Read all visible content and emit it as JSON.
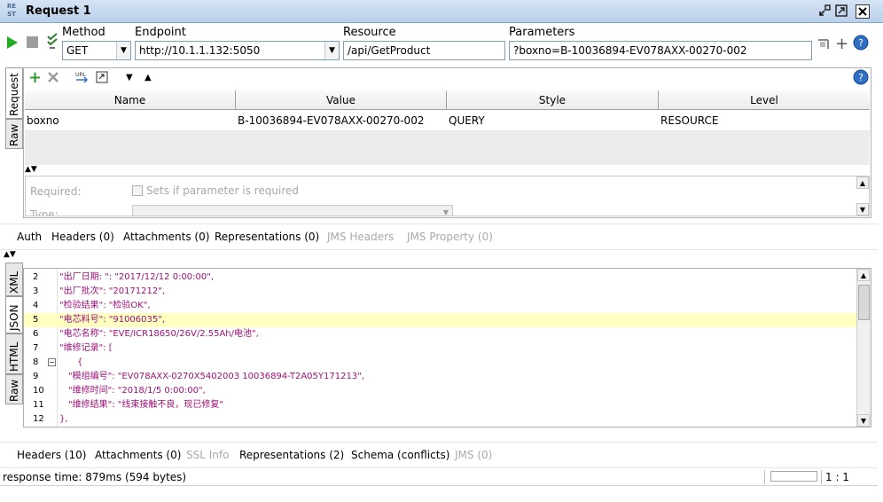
{
  "window": {
    "app_logo_text": "RE ST",
    "title": "Request 1",
    "controls": [
      "detach-icon",
      "maximize-icon",
      "close-icon"
    ]
  },
  "toolbar": {
    "method_label": "Method",
    "method_value": "GET",
    "endpoint_label": "Endpoint",
    "endpoint_value": "http://10.1.1.132:5050",
    "resource_label": "Resource",
    "resource_value": "/api/GetProduct",
    "parameters_label": "Parameters",
    "parameters_value": "?boxno=B-10036894-EV078AXX-00270-002"
  },
  "side_tabs_top": [
    "Request",
    "Raw"
  ],
  "params_table": {
    "columns": [
      "Name",
      "Value",
      "Style",
      "Level"
    ],
    "rows": [
      [
        "boxno",
        "B-10036894-EV078AXX-00270-002",
        "QUERY",
        "RESOURCE"
      ]
    ]
  },
  "param_detail": {
    "required_label": "Required:",
    "required_checkbox_text": "Sets if parameter is required",
    "type_label": "Type:"
  },
  "request_tabs": [
    {
      "label": "Auth",
      "disabled": false
    },
    {
      "label": "Headers (0)",
      "disabled": false
    },
    {
      "label": "Attachments (0)",
      "disabled": false
    },
    {
      "label": "Representations (0)",
      "disabled": false
    },
    {
      "label": "JMS Headers",
      "disabled": true
    },
    {
      "label": "JMS Property (0)",
      "disabled": true
    }
  ],
  "side_tabs_bottom": [
    "XML",
    "JSON",
    "HTML",
    "Raw"
  ],
  "response_code": {
    "lines": [
      {
        "n": "2",
        "text": "\"出厂日期: \": \"2017/12/12 0:00:00\",",
        "indent": 0,
        "highlight": false,
        "fold": false
      },
      {
        "n": "3",
        "text": "\"出厂批次\": \"20171212\",",
        "indent": 0,
        "highlight": false,
        "fold": false
      },
      {
        "n": "4",
        "text": "\"检验结果\": \"检验OK\",",
        "indent": 0,
        "highlight": false,
        "fold": false
      },
      {
        "n": "5",
        "text": "\"电芯料号\": \"91006035\",",
        "indent": 0,
        "highlight": true,
        "fold": false
      },
      {
        "n": "6",
        "text": "\"电芯名称\": \"EVE/ICR18650/26V/2.55Ah/电池\",",
        "indent": 0,
        "highlight": false,
        "fold": false
      },
      {
        "n": "7",
        "text": "\"维修记录\":   [",
        "indent": 0,
        "highlight": false,
        "fold": false
      },
      {
        "n": "8",
        "text": "{",
        "indent": 2,
        "highlight": false,
        "fold": true
      },
      {
        "n": "9",
        "text": "\"模组编号\": \"EV078AXX-0270X5402003 10036894-T2A05Y171213\",",
        "indent": 1,
        "highlight": false,
        "fold": false
      },
      {
        "n": "10",
        "text": "\"维修时间\": \"2018/1/5 0:00:00\",",
        "indent": 1,
        "highlight": false,
        "fold": false
      },
      {
        "n": "11",
        "text": "\"维修结果\": \"线束接触不良，现已修复\"",
        "indent": 1,
        "highlight": false,
        "fold": false
      },
      {
        "n": "12",
        "text": "},",
        "indent": 0,
        "highlight": false,
        "fold": false
      }
    ]
  },
  "response_tabs": [
    {
      "label": "Headers (10)",
      "disabled": false
    },
    {
      "label": "Attachments (0)",
      "disabled": false
    },
    {
      "label": "SSL Info",
      "disabled": true
    },
    {
      "label": "Representations (2)",
      "disabled": false
    },
    {
      "label": "Schema (conflicts)",
      "disabled": false
    },
    {
      "label": "JMS (0)",
      "disabled": true
    }
  ],
  "status": {
    "response_time": "response time: 879ms (594 bytes)",
    "position": "1 : 1"
  },
  "colors": {
    "code_text": "#a0107a",
    "highlight_line": "#ffffc0",
    "run_button": "#22aa22",
    "add_icon": "#2e9b2e"
  }
}
